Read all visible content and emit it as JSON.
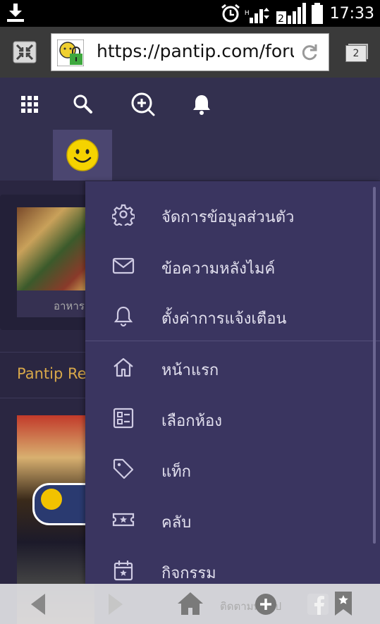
{
  "status_bar": {
    "time": "17:33",
    "download_icon": "download-icon",
    "alarm_icon": "alarm-icon",
    "network_type": "H",
    "signal_icons": [
      "signal-1-icon",
      "signal-2-icon"
    ],
    "battery_icon": "battery-icon"
  },
  "browser": {
    "url": "https://pantip.com/forum",
    "tab_count": "2",
    "exit_fullscreen_icon": "exit-fullscreen-icon",
    "site_security_icon": "site-lock-icon",
    "reload_icon": "reload-icon"
  },
  "site_header": {
    "nav_icons": [
      "apps-grid-icon",
      "search-icon",
      "zoom-in-icon",
      "notification-bell-icon"
    ],
    "avatar_icon": "smiley-avatar-icon"
  },
  "background": {
    "card_caption": "อาหาร",
    "section_title": "Pantip Review"
  },
  "menu": {
    "items": [
      {
        "label": "จัดการข้อมูลส่วนตัว",
        "icon": "gear-icon"
      },
      {
        "label": "ข้อความหลังไมค์",
        "icon": "mail-icon"
      },
      {
        "label": "ตั้งค่าการแจ้งเตือน",
        "icon": "bell-icon"
      },
      {
        "label": "หน้าแรก",
        "icon": "home-icon"
      },
      {
        "label": "เลือกห้อง",
        "icon": "room-list-icon"
      },
      {
        "label": "แท็ก",
        "icon": "tag-icon"
      },
      {
        "label": "คลับ",
        "icon": "ticket-star-icon"
      },
      {
        "label": "กิจกรรม",
        "icon": "calendar-star-icon"
      }
    ]
  },
  "bottom_bar": {
    "follow_text": "ติดตามพันทิป",
    "icons": [
      "back-arrow-icon",
      "forward-arrow-icon",
      "home-icon",
      "add-icon",
      "facebook-icon",
      "bookmark-star-icon"
    ]
  },
  "colors": {
    "header_bg": "#33304f",
    "menu_bg": "#3a3560",
    "menu_text": "#e2e0ee",
    "accent_gold": "#d8a84a"
  }
}
